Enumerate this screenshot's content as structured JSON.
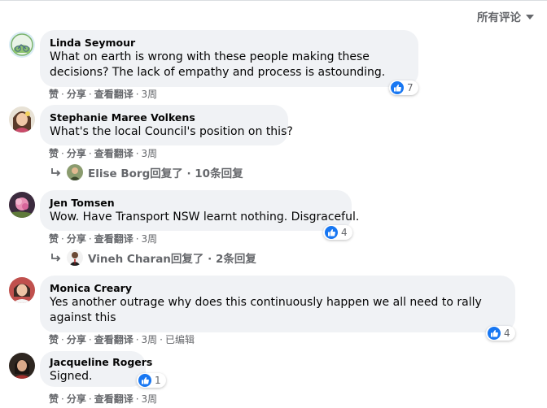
{
  "header": {
    "sort_label": "所有评论"
  },
  "actions": {
    "like": "赞",
    "share": "分享",
    "translate": "查看翻译",
    "edited": "已编辑",
    "dot": "·"
  },
  "comments": [
    {
      "author": "Linda Seymour",
      "text": "What on earth is wrong with these people making these decisions? The lack of empathy and process is astounding.",
      "time": "3周",
      "reactions": "7"
    },
    {
      "author": "Stephanie Maree Volkens",
      "text": "What's the local Council's position on this?",
      "time": "3周",
      "reply_text": "Elise Borg回复了 · 10条回复"
    },
    {
      "author": "Jen Tomsen",
      "text": "Wow. Have Transport NSW learnt nothing. Disgraceful.",
      "time": "3周",
      "reactions": "4",
      "reply_text": "Vineh Charan回复了 · 2条回复"
    },
    {
      "author": "Monica Creary",
      "text": "Yes another outrage why does this continuously happen we all need to rally against this",
      "time": "3周",
      "reactions": "4"
    },
    {
      "author": "Jacqueline Rogers",
      "text": "Signed.",
      "time": "3周",
      "reactions": "1"
    }
  ],
  "colors": {
    "bubble": "#f0f2f5",
    "meta": "#65676b",
    "like_blue": "#1877f2"
  }
}
